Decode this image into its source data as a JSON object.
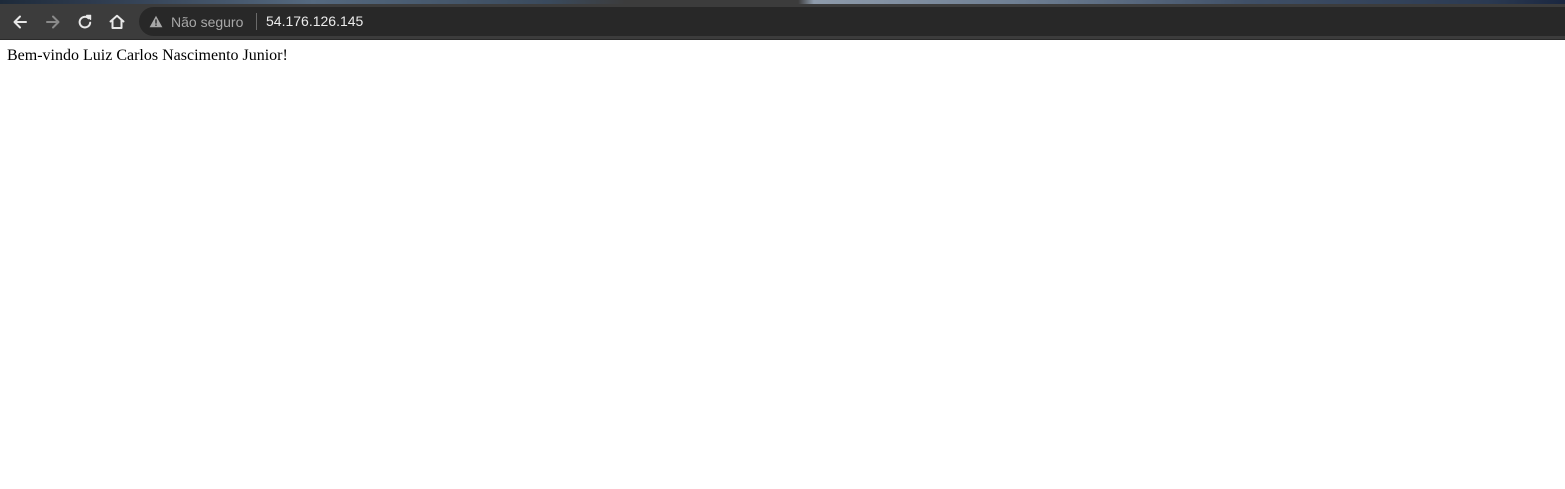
{
  "browser": {
    "colors": {
      "toolbar": "#3c3c3c",
      "omnibox": "#282828",
      "icon": "#e8e8e8",
      "icon_disabled": "#8a8a8a",
      "security_text": "#a8a8a8",
      "url_text": "#ececec"
    },
    "nav": {
      "back_icon": "arrow-left",
      "forward_icon": "arrow-right",
      "forward_enabled": false,
      "reload_icon": "reload",
      "home_icon": "home"
    },
    "omnibox": {
      "security_icon": "warning-triangle",
      "security_label": "Não seguro",
      "url": "54.176.126.145"
    }
  },
  "page": {
    "background": "#ffffff",
    "message": "Bem-vindo Luiz Carlos Nascimento Junior!"
  }
}
